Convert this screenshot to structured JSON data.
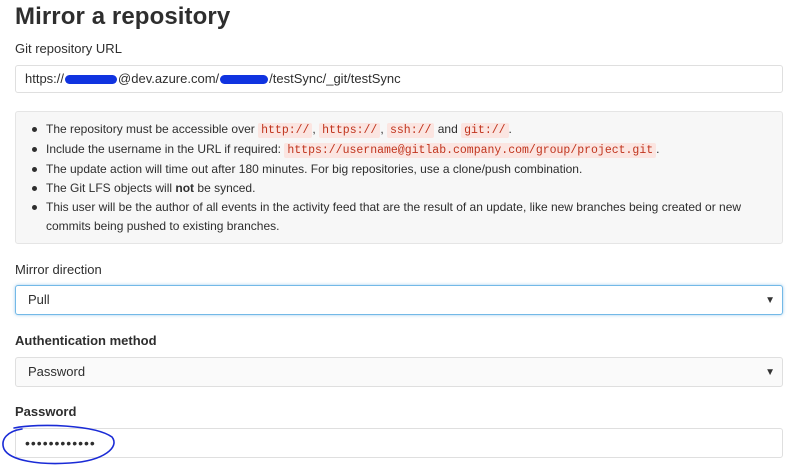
{
  "page_title": "Mirror a repository",
  "git_url": {
    "label": "Git repository URL",
    "value_prefix": "https://",
    "value_middle": "@dev.azure.com/",
    "value_suffix": "/testSync/_git/testSync"
  },
  "hints": {
    "item1_text": "The repository must be accessible over",
    "item1_codes": [
      "http://",
      "https://",
      "ssh://",
      "git://"
    ],
    "item1_and": "and",
    "item2_text": "Include the username in the URL if required:",
    "item2_code": "https://username@gitlab.company.com/group/project.git",
    "item3_text": "The update action will time out after 180 minutes. For big repositories, use a clone/push combination.",
    "item4_before": "The Git LFS objects will",
    "item4_bold": "not",
    "item4_after": "be synced.",
    "item5_text": "This user will be the author of all events in the activity feed that are the result of an update, like new branches being created or new commits being pushed to existing branches."
  },
  "mirror_direction": {
    "label": "Mirror direction",
    "selected": "Pull"
  },
  "auth_method": {
    "label": "Authentication method",
    "selected": "Password"
  },
  "password": {
    "label": "Password",
    "value": "••••••••••••"
  },
  "colors": {
    "annotation": "#1a2bd6",
    "redaction": "#1033e0",
    "code_text": "#c0341d",
    "code_bg": "#fbe5e1"
  }
}
